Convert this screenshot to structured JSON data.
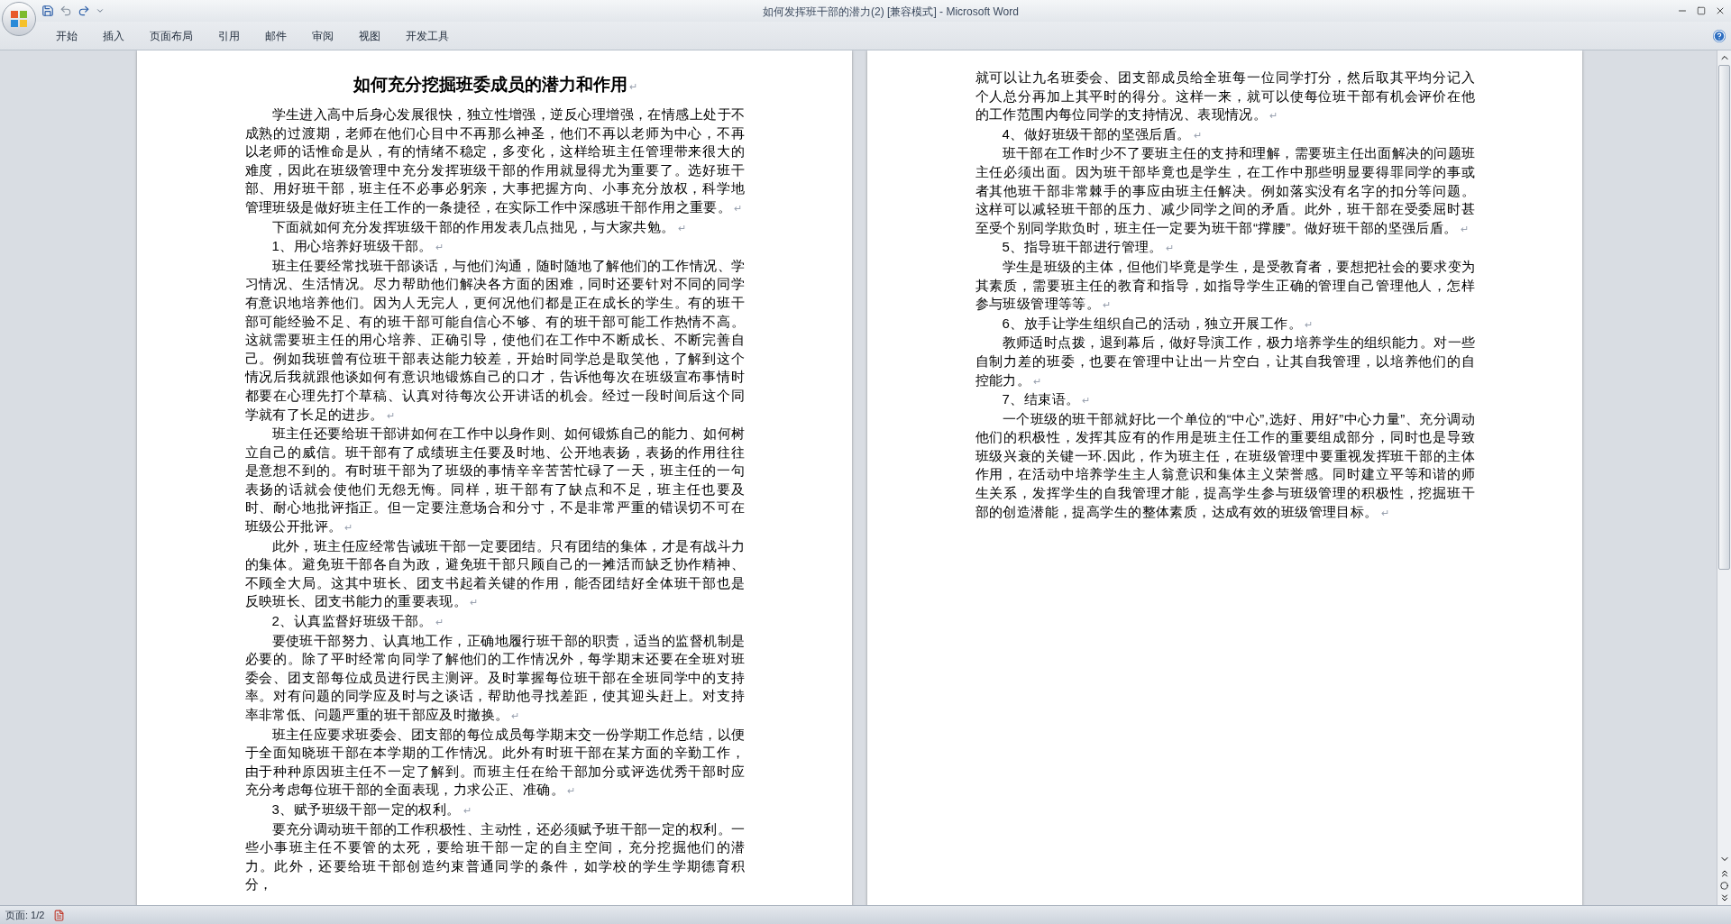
{
  "window": {
    "title": "如何发挥班干部的潜力(2) [兼容模式] - Microsoft Word"
  },
  "ribbon_tabs": [
    {
      "label": "开始"
    },
    {
      "label": "插入"
    },
    {
      "label": "页面布局"
    },
    {
      "label": "引用"
    },
    {
      "label": "邮件"
    },
    {
      "label": "审阅"
    },
    {
      "label": "视图"
    },
    {
      "label": "开发工具"
    }
  ],
  "pages": [
    {
      "title": {
        "text": "如何充分挖掘班委成员的潜力和作用",
        "mark": "↵"
      },
      "paragraphs": [
        {
          "text": "学生进入高中后身心发展很快，独立性增强，逆反心理增强，在情感上处于不成熟的过渡期，老师在他们心目中不再那么神圣，他们不再以老师为中心，不再以老师的话惟命是从，有的情绪不稳定，多变化，这样给班主任管理带来很大的难度，因此在班级管理中充分发挥班级干部的作用就显得尤为重要了。选好班干部、用好班干部，班主任不必事必躬亲，大事把握方向、小事充分放权，科学地管理班级是做好班主任工作的一条捷径，在实际工作中深感班干部作用之重要。",
          "continued": false,
          "mark": "↵"
        },
        {
          "text": "下面就如何充分发挥班级干部的作用发表几点拙见，与大家共勉。",
          "continued": false,
          "mark": "↵"
        },
        {
          "text": "1、用心培养好班级干部。",
          "continued": false,
          "mark": "↵"
        },
        {
          "text": "班主任要经常找班干部谈话，与他们沟通，随时随地了解他们的工作情况、学习情况、生活情况。尽力帮助他们解决各方面的困难，同时还要针对不同的同学有意识地培养他们。因为人无完人，更何况他们都是正在成长的学生。有的班干部可能经验不足、有的班干部可能自信心不够、有的班干部可能工作热情不高。这就需要班主任的用心培养、正确引导，使他们在工作中不断成长、不断完善自己。例如我班曾有位班干部表达能力较差，开始时同学总是取笑他，了解到这个情况后我就跟他谈如何有意识地锻炼自己的口才，告诉他每次在班级宣布事情时都要在心理先打个草稿、认真对待每次公开讲话的机会。经过一段时间后这个同学就有了长足的进步。",
          "continued": false,
          "mark": "↵"
        },
        {
          "text": "班主任还要给班干部讲如何在工作中以身作则、如何锻炼自己的能力、如何树立自己的威信。班干部有了成绩班主任要及时地、公开地表扬，表扬的作用往往是意想不到的。有时班干部为了班级的事情辛辛苦苦忙碌了一天，班主任的一句表扬的话就会使他们无怨无悔。同样，班干部有了缺点和不足，班主任也要及时、耐心地批评指正。但一定要注意场合和分寸，不是非常严重的错误切不可在班级公开批评。",
          "continued": false,
          "mark": "↵"
        },
        {
          "text": "此外，班主任应经常告诫班干部一定要团结。只有团结的集体，才是有战斗力的集体。避免班干部各自为政，避免班干部只顾自己的一摊活而缺乏协作精神、不顾全大局。这其中班长、团支书起着关键的作用，能否团结好全体班干部也是反映班长、团支书能力的重要表现。",
          "continued": false,
          "mark": "↵"
        },
        {
          "text": "2、认真监督好班级干部。",
          "continued": false,
          "mark": "↵"
        },
        {
          "text": "要使班干部努力、认真地工作，正确地履行班干部的职责，适当的监督机制是必要的。除了平时经常向同学了解他们的工作情况外，每学期末还要在全班对班委会、团支部每位成员进行民主测评。及时掌握每位班干部在全班同学中的支持率。对有问题的同学应及时与之谈话，帮助他寻找差距，使其迎头赶上。对支持率非常低、问题严重的班干部应及时撤换。",
          "continued": false,
          "mark": "↵"
        },
        {
          "text": "班主任应要求班委会、团支部的每位成员每学期末交一份学期工作总结，以便于全面知晓班干部在本学期的工作情况。此外有时班干部在某方面的辛勤工作，由于种种原因班主任不一定了解到。而班主任在给干部加分或评选优秀干部时应充分考虑每位班干部的全面表现，力求公正、准确。",
          "continued": false,
          "mark": "↵"
        },
        {
          "text": "3、赋予班级干部一定的权利。",
          "continued": false,
          "mark": "↵"
        },
        {
          "text": "要充分调动班干部的工作积极性、主动性，还必须赋予班干部一定的权利。一些小事班主任不要管的太死，要给班干部一定的自主空间，充分挖掘他们的潜力。此外，还要给班干部创造约束普通同学的条件，如学校的学生学期德育积分，",
          "continued": false
        }
      ]
    },
    {
      "paragraphs": [
        {
          "text": "就可以让九名班委会、团支部成员给全班每一位同学打分，然后取其平均分记入个人总分再加上其平时的得分。这样一来，就可以使每位班干部有机会评价在他的工作范围内每位同学的支持情况、表现情况。",
          "continued": true,
          "mark": "↵"
        },
        {
          "text": "4、做好班级干部的坚强后盾。",
          "continued": false,
          "mark": "↵"
        },
        {
          "text": "班干部在工作时少不了要班主任的支持和理解，需要班主任出面解决的问题班主任必须出面。因为班干部毕竟也是学生，在工作中那些明显要得罪同学的事或者其他班干部非常棘手的事应由班主任解决。例如落实没有名字的扣分等问题。这样可以减轻班干部的压力、减少同学之间的矛盾。此外，班干部在受委屈时甚至受个别同学欺负时，班主任一定要为班干部“撑腰”。做好班干部的坚强后盾。",
          "continued": false,
          "mark": "↵"
        },
        {
          "text": "5、指导班干部进行管理。",
          "continued": false,
          "mark": "↵"
        },
        {
          "text": "学生是班级的主体，但他们毕竟是学生，是受教育者，要想把社会的要求变为其素质，需要班主任的教育和指导，如指导学生正确的管理自己管理他人，怎样参与班级管理等等。",
          "continued": false,
          "mark": "↵"
        },
        {
          "text": "6、放手让学生组织自己的活动，独立开展工作。",
          "continued": false,
          "mark": "↵"
        },
        {
          "text": "教师适时点拨，退到幕后，做好导演工作，极力培养学生的组织能力。对一些自制力差的班委，也要在管理中让出一片空白，让其自我管理，以培养他们的自控能力。",
          "continued": false,
          "mark": "↵"
        },
        {
          "text": "7、结束语。",
          "continued": false,
          "mark": "↵"
        },
        {
          "text": "一个班级的班干部就好比一个单位的“中心”,选好、用好”中心力量”、充分调动他们的积极性，发挥其应有的作用是班主任工作的重要组成部分，同时也是导致班级兴衰的关键一环.因此，作为班主任，在班级管理中要重视发挥班干部的主体作用，在活动中培养学生主人翁意识和集体主义荣誉感。同时建立平等和谐的师生关系，发挥学生的自我管理才能，提高学生参与班级管理的积极性，挖掘班干部的创造潜能，提高学生的整体素质，达成有效的班级管理目标。",
          "continued": false,
          "mark": "↵"
        }
      ]
    }
  ],
  "status_bar": {
    "page": "页面: 1/2"
  }
}
